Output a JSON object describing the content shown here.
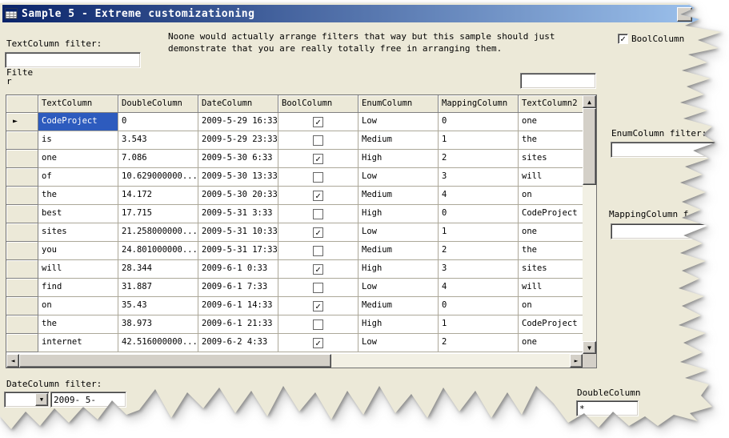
{
  "window": {
    "title": "Sample 5 - Extreme customizationing"
  },
  "description": "Noone would actually arrange filters that way but this sample should just\ndemonstrate that you are really totally free in arranging them.",
  "colors": {
    "titlebar_start": "#0A246A",
    "titlebar_end": "#9CC1EC",
    "window_bg": "#ECE9D8",
    "control_face": "#D4D0C8",
    "gridline": "#ACA899",
    "selection_bg": "#2D5BBE",
    "selection_text": "#FFFFFF"
  },
  "icons": {
    "check": "✓",
    "up": "▲",
    "down": "▼",
    "left": "◄",
    "right": "►",
    "dropdown": "▼",
    "row_current": "►"
  },
  "filters": {
    "textcolumn_label": "TextColumn filter:",
    "textcolumn_value": "",
    "wrapped_filter_label": "Filte\nr",
    "top_right_value": "",
    "boolcolumn_label": "BoolColumn",
    "boolcolumn_checked": true,
    "enumcolumn_label": "EnumColumn filter:",
    "enumcolumn_value": "",
    "mappingcolumn_label": "MappingColumn f",
    "mappingcolumn_value": "",
    "datecolumn_label": "DateColumn filter:",
    "datecolumn_combo_value": "",
    "datecolumn_date_value": "2009- 5-",
    "doublecolumn_label": "DoubleColumn",
    "doublecolumn_value": "*"
  },
  "grid": {
    "columns": [
      "TextColumn",
      "DoubleColumn",
      "DateColumn",
      "BoolColumn",
      "EnumColumn",
      "MappingColumn",
      "TextColumn2"
    ],
    "rows": [
      [
        "CodeProject",
        "0",
        "2009-5-29 16:33",
        true,
        "Low",
        "0",
        "one"
      ],
      [
        "is",
        "3.543",
        "2009-5-29 23:33",
        false,
        "Medium",
        "1",
        "the"
      ],
      [
        "one",
        "7.086",
        "2009-5-30 6:33",
        true,
        "High",
        "2",
        "sites"
      ],
      [
        "of",
        "10.629000000...",
        "2009-5-30 13:33",
        false,
        "Low",
        "3",
        "will"
      ],
      [
        "the",
        "14.172",
        "2009-5-30 20:33",
        true,
        "Medium",
        "4",
        "on"
      ],
      [
        "best",
        "17.715",
        "2009-5-31 3:33",
        false,
        "High",
        "0",
        "CodeProject"
      ],
      [
        "sites",
        "21.258000000...",
        "2009-5-31 10:33",
        true,
        "Low",
        "1",
        "one"
      ],
      [
        "you",
        "24.801000000...",
        "2009-5-31 17:33",
        false,
        "Medium",
        "2",
        "the"
      ],
      [
        "will",
        "28.344",
        "2009-6-1 0:33",
        true,
        "High",
        "3",
        "sites"
      ],
      [
        "find",
        "31.887",
        "2009-6-1 7:33",
        false,
        "Low",
        "4",
        "will"
      ],
      [
        "on",
        "35.43",
        "2009-6-1 14:33",
        true,
        "Medium",
        "0",
        "on"
      ],
      [
        "the",
        "38.973",
        "2009-6-1 21:33",
        false,
        "High",
        "1",
        "CodeProject"
      ],
      [
        "internet",
        "42.516000000...",
        "2009-6-2 4:33",
        true,
        "Low",
        "2",
        "one"
      ]
    ],
    "selected_row": 0,
    "selected_column": 0,
    "bool_column_index": 3
  }
}
